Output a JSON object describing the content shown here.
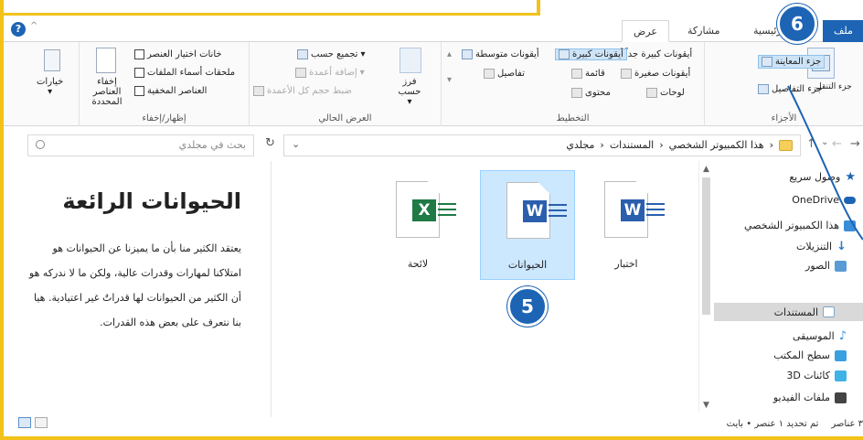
{
  "tabs": {
    "file": "ملف",
    "home": "الرئيسية",
    "share": "مشاركة",
    "view": "عرض"
  },
  "ribbon": {
    "panes": {
      "preview_pane": "جزء المعاينة",
      "details_pane": "جزء التفاصيل",
      "nav_pane": "جزء التنقل",
      "label": "الأجزاء"
    },
    "layout": {
      "xl_icons": "أيقونات كبيرة جداً",
      "large_icons": "أيقونات كبيرة",
      "medium_icons": "أيقونات متوسطة",
      "small_icons": "أيقونات صغيرة",
      "list": "قائمة",
      "details": "تفاصيل",
      "tiles": "لوحات",
      "content": "محتوى",
      "label": "التخطيط"
    },
    "current_view": {
      "sort_by": "فرز حسب",
      "group_by": "تجميع حسب",
      "add_columns": "إضافة أعمدة",
      "size_columns": "ضبط حجم كل الأعمدة",
      "label": "العرض الحالي"
    },
    "show_hide": {
      "item_checkboxes": "خانات اختيار العنصر",
      "file_extensions": "ملحقات أسماء الملفات",
      "hidden_items": "العناصر المخفية",
      "hide_selected": "إخفاء العناصر المحددة",
      "label": "إظهار/إخفاء"
    },
    "options": "خيارات"
  },
  "address": {
    "crumbs": [
      "هذا الكمبيوتر الشخصي",
      "المستندات",
      "مجلدي"
    ],
    "search_placeholder": "بحث في مجلدي"
  },
  "files": [
    {
      "name": "اختبار",
      "type": "word"
    },
    {
      "name": "الحيوانات",
      "type": "word"
    },
    {
      "name": "لائحة",
      "type": "excel"
    }
  ],
  "preview": {
    "title": "الحيوانات الرائعة",
    "body": "يعتقد الكثير منا بأن ما يميزنا عن الحيوانات هو امتلاكنا لمهارات وقدرات عالية، ولكن ما لا ندركه هو أن الكثير من الحيوانات لها قدراتٌ غير اعتيادية. هيا بنا نتعرف على بعض هذه القدرات."
  },
  "nav": [
    {
      "label": "وصول سريع",
      "icon": "star-icon",
      "color": "#1d64b4"
    },
    {
      "label": "OneDrive",
      "icon": "cloud-icon",
      "color": "#1d64b4"
    },
    {
      "label": "هذا الكمبيوتر الشخصي",
      "icon": "computer-icon",
      "color": "#3a8ed8"
    },
    {
      "label": "التنزيلات",
      "icon": "download-icon",
      "color": "#2a78c8"
    },
    {
      "label": "الصور",
      "icon": "pictures-icon",
      "color": "#5b9bd5"
    },
    {
      "label": "المستندات",
      "icon": "documents-icon",
      "color": "#7fa6cc"
    },
    {
      "label": "الموسيقى",
      "icon": "music-icon",
      "color": "#2f8fe0"
    },
    {
      "label": "سطح المكتب",
      "icon": "desktop-icon",
      "color": "#3aa0e0"
    },
    {
      "label": "كائنات 3D",
      "icon": "cube-icon",
      "color": "#3fb3e6"
    },
    {
      "label": "ملفات الفيديو",
      "icon": "video-icon",
      "color": "#444444"
    }
  ],
  "status": {
    "count": "٣ عناصر",
    "selected": "تم تحديد ١ عنصر • بايت"
  },
  "callouts": {
    "a": "6",
    "b": "5"
  },
  "colors": {
    "accent": "#1d64b4",
    "frame": "#f2c21b",
    "word": "#2b5fad",
    "excel": "#1f7a45"
  }
}
